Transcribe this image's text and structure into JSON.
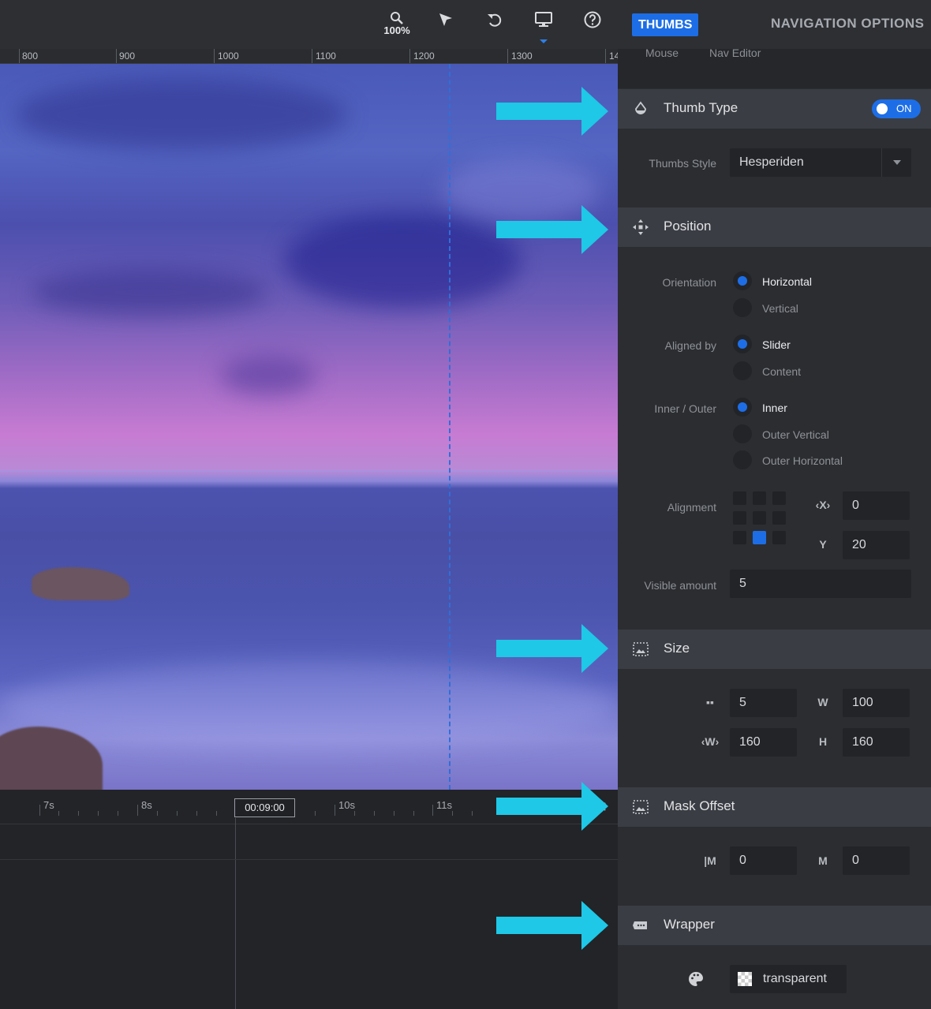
{
  "toolbar": {
    "zoom_label": "100%",
    "tools": [
      "search-zoom-icon",
      "cursor-arrow-icon",
      "undo-icon",
      "desktop-monitor-icon",
      "help-circle-icon"
    ]
  },
  "ruler": {
    "labels": [
      "800",
      "900",
      "1000",
      "1100",
      "1200",
      "1300",
      "14"
    ]
  },
  "timeline": {
    "labels": [
      "7s",
      "8s",
      "10s",
      "11s"
    ],
    "current_time": "00:09:00"
  },
  "panel": {
    "tabs": {
      "active": "THUMBS",
      "other": "NAVIGATION OPTIONS"
    },
    "subtabs": [
      "Mouse",
      "Nav Editor"
    ],
    "thumb_type": {
      "title": "Thumb Type",
      "toggle": "ON",
      "style_label": "Thumbs Style",
      "style_value": "Hesperiden"
    },
    "position": {
      "title": "Position",
      "orientation_label": "Orientation",
      "orientation_options": [
        "Horizontal",
        "Vertical"
      ],
      "aligned_label": "Aligned by",
      "aligned_options": [
        "Slider",
        "Content"
      ],
      "inner_outer_label": "Inner / Outer",
      "inner_outer_options": [
        "Inner",
        "Outer Vertical",
        "Outer Horizontal"
      ],
      "alignment_label": "Alignment",
      "x_value": "0",
      "y_value": "20",
      "visible_label": "Visible amount",
      "visible_value": "5"
    },
    "size": {
      "title": "Size",
      "gap_value": "5",
      "width_percent_value": "100",
      "width_value": "160",
      "height_value": "160"
    },
    "mask_offset": {
      "title": "Mask Offset",
      "left_value": "0",
      "top_value": "0"
    },
    "wrapper": {
      "title": "Wrapper",
      "color_value": "transparent"
    }
  },
  "colors": {
    "accent": "#1d6ee6",
    "arrow": "#1ec8e6",
    "panel_bg": "#2b2d31",
    "section_bg": "#3a3d43"
  }
}
